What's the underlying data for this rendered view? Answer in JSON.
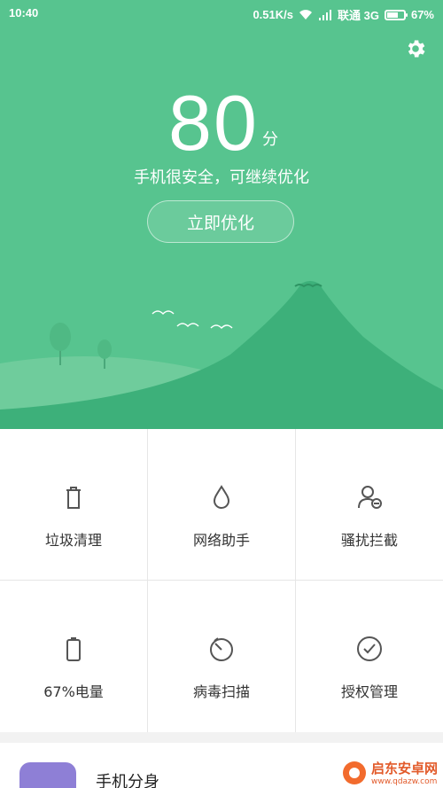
{
  "status_bar": {
    "time": "10:40",
    "speed": "0.51K/s",
    "carrier": "联通 3G",
    "battery": "67%",
    "battery_level": 0.67
  },
  "score": {
    "value": "80",
    "unit": "分",
    "message": "手机很安全，可继续优化"
  },
  "optimize_button": "立即优化",
  "grid": [
    {
      "label": "垃圾清理",
      "icon": "trash-icon"
    },
    {
      "label": "网络助手",
      "icon": "drop-icon"
    },
    {
      "label": "骚扰拦截",
      "icon": "user-block-icon"
    },
    {
      "label": "67%电量",
      "icon": "battery-icon"
    },
    {
      "label": "病毒扫描",
      "icon": "scan-icon"
    },
    {
      "label": "授权管理",
      "icon": "check-circle-icon"
    }
  ],
  "bottom_item": {
    "label": "手机分身",
    "icon": "dual-app-icon"
  },
  "watermark": {
    "text": "启东安卓网",
    "sub": "www.qdazw.com"
  },
  "colors": {
    "hero_green": "#57c48f",
    "mountain_green": "#3db07a"
  }
}
